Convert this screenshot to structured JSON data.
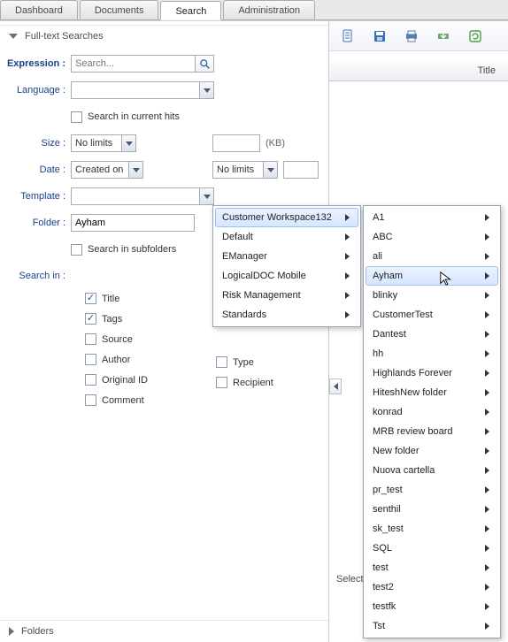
{
  "tabs": {
    "dashboard": "Dashboard",
    "documents": "Documents",
    "search": "Search",
    "administration": "Administration"
  },
  "section": {
    "fulltext": "Full-text Searches",
    "folders": "Folders"
  },
  "form": {
    "expression_label": "Expression :",
    "expression_placeholder": "Search...",
    "language_label": "Language :",
    "language_value": "",
    "search_current": "Search in current hits",
    "size_label": "Size :",
    "size_value": "No limits",
    "kb": "(KB)",
    "date_label": "Date :",
    "date_value": "Created on",
    "date_range": "No limits",
    "template_label": "Template :",
    "template_value": "",
    "folder_label": "Folder :",
    "folder_value": "Ayham",
    "search_subfolders": "Search in subfolders",
    "searchin_label": "Search in :",
    "chk_title": "Title",
    "chk_tags": "Tags",
    "chk_source": "Source",
    "chk_author": "Author",
    "chk_originalid": "Original ID",
    "chk_comment": "Comment",
    "chk_type": "Type",
    "chk_recipient": "Recipient"
  },
  "grid": {
    "col_title": "Title",
    "select": "Select"
  },
  "menu1": {
    "items": [
      "Customer Workspace132",
      "Default",
      "EManager",
      "LogicalDOC Mobile",
      "Risk Management",
      "Standards"
    ],
    "hover_index": 0
  },
  "menu2": {
    "items": [
      "A1",
      "ABC",
      "ali",
      "Ayham",
      "blinky",
      "CustomerTest",
      "Dantest",
      "hh",
      "Highlands Forever",
      "HiteshNew folder",
      "konrad",
      "MRB review board",
      "New folder",
      "Nuova cartella",
      "pr_test",
      "senthil",
      "sk_test",
      "SQL",
      "test",
      "test2",
      "testfk",
      "Tst"
    ],
    "hover_index": 3
  }
}
